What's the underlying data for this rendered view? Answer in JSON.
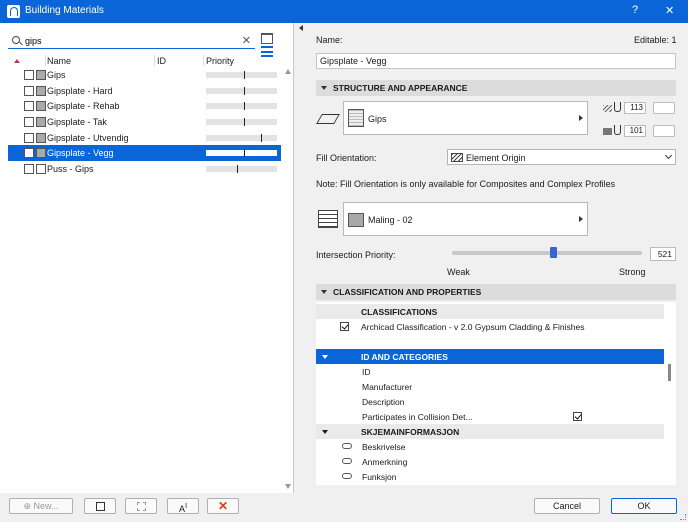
{
  "window": {
    "title": "Building Materials",
    "help_label": "?",
    "close_label": "✕"
  },
  "search": {
    "value": "gips",
    "clear_label": "✕"
  },
  "list": {
    "headers": {
      "name": "Name",
      "id": "ID",
      "priority": "Priority"
    },
    "rows": [
      {
        "name": "Gips",
        "priority": 0.54,
        "swatch": "gray"
      },
      {
        "name": "Gipsplate - Hard",
        "priority": 0.54,
        "swatch": "gray"
      },
      {
        "name": "Gipsplate - Rehab",
        "priority": 0.54,
        "swatch": "gray"
      },
      {
        "name": "Gipsplate - Tak",
        "priority": 0.54,
        "swatch": "gray"
      },
      {
        "name": "Gipsplate - Utvendig",
        "priority": 0.77,
        "swatch": "gray"
      },
      {
        "name": "Gipsplate - Vegg",
        "priority": 0.54,
        "swatch": "gray",
        "selected": true
      },
      {
        "name": "Puss - Gips",
        "priority": 0.44,
        "swatch": "light"
      }
    ]
  },
  "left_buttons": {
    "new_label": "New..."
  },
  "properties": {
    "name_label": "Name:",
    "editable_label": "Editable: 1",
    "name_value": "Gipsplate - Vegg",
    "structure_section": "STRUCTURE AND APPEARANCE",
    "surface": "Gips",
    "cut_line_pen": "113",
    "cut_fill_pen": "101",
    "fill_orientation_label": "Fill Orientation:",
    "fill_orientation_value": "Element Origin",
    "note": "Note: Fill Orientation is only available for Composites and Complex Profiles",
    "cut_fill": "Maling - 02",
    "intersection_label": "Intersection Priority:",
    "intersection_value": "521",
    "intersection_fraction": 0.53,
    "weak_label": "Weak",
    "strong_label": "Strong",
    "classification_section": "CLASSIFICATION AND PROPERTIES"
  },
  "classification": {
    "classifications_header": "CLASSIFICATIONS",
    "classification_item": "Archicad Classification - v 2.0 Gypsum Cladding & Finishes",
    "id_categories_header": "ID AND CATEGORIES",
    "id_rows": [
      "ID",
      "Manufacturer",
      "Description",
      "Participates in Collision Det..."
    ],
    "skjema_header": "SKJEMAINFORMASJON",
    "skjema_rows": [
      "Beskrivelse",
      "Anmerkning",
      "Funksjon"
    ]
  },
  "footer": {
    "cancel_label": "Cancel",
    "ok_label": "OK"
  }
}
